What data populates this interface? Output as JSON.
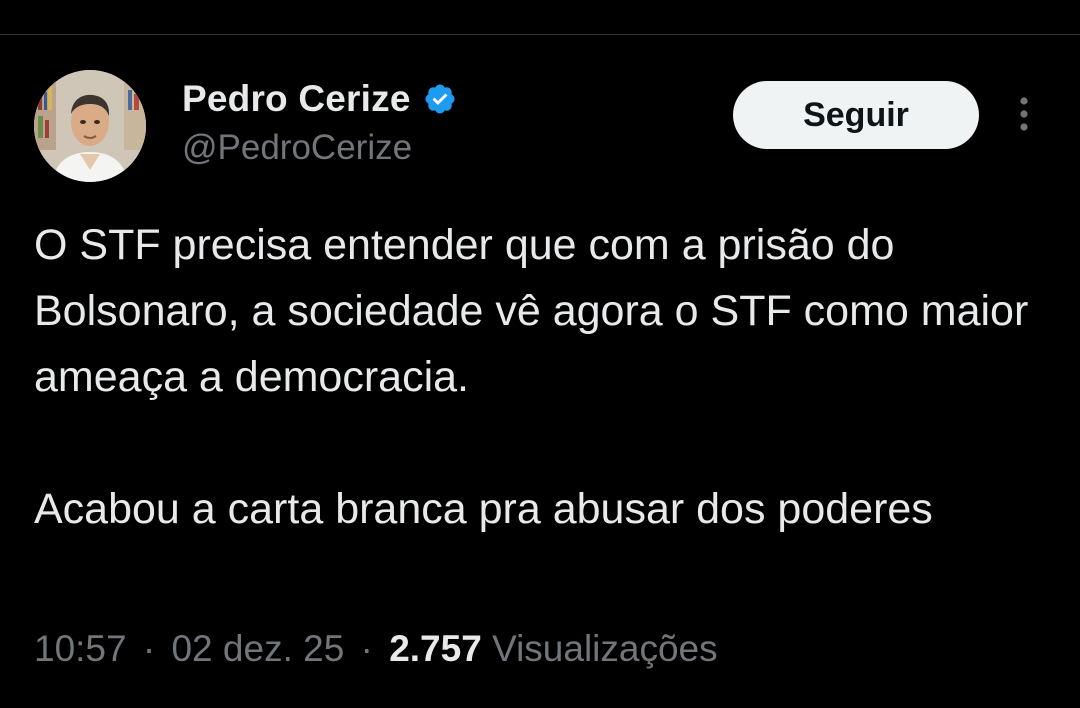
{
  "author": {
    "display_name": "Pedro Cerize",
    "handle": "@PedroCerize",
    "verified": true,
    "avatar_icon": "profile-photo"
  },
  "actions": {
    "follow_label": "Seguir",
    "more_icon": "more-vertical-icon"
  },
  "tweet": {
    "paragraphs": [
      "O STF precisa entender que com a prisão do Bolsonaro, a sociedade vê agora o STF como maior ameaça a democracia.",
      "Acabou a carta branca pra abusar dos poderes"
    ]
  },
  "meta": {
    "time": "10:57",
    "separator": "·",
    "date": "02 dez. 25",
    "views_count": "2.757",
    "views_label": "Visualizações"
  },
  "colors": {
    "background": "#000000",
    "primary_text": "#e7e9ea",
    "secondary_text": "#71767b",
    "verified_blue": "#1d9bf0",
    "button_bg": "#eff3f4",
    "divider": "#2f3336"
  }
}
